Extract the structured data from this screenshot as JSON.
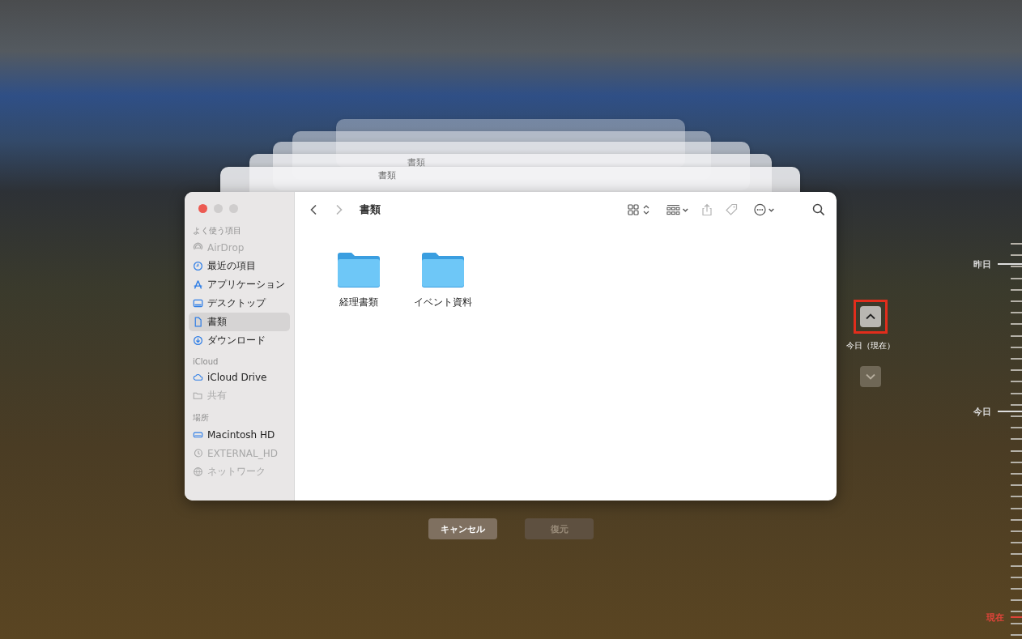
{
  "back_window_titles": [
    "書類",
    "書類"
  ],
  "window": {
    "title": "書類",
    "back_enabled": true,
    "forward_enabled": false
  },
  "sidebar": {
    "sections": [
      {
        "header": "よく使う項目",
        "items": [
          {
            "label": "AirDrop",
            "selected": false,
            "disabled": true
          },
          {
            "label": "最近の項目",
            "selected": false,
            "disabled": false
          },
          {
            "label": "アプリケーション",
            "selected": false,
            "disabled": false
          },
          {
            "label": "デスクトップ",
            "selected": false,
            "disabled": false
          },
          {
            "label": "書類",
            "selected": true,
            "disabled": false
          },
          {
            "label": "ダウンロード",
            "selected": false,
            "disabled": false
          }
        ]
      },
      {
        "header": "iCloud",
        "items": [
          {
            "label": "iCloud Drive",
            "selected": false,
            "disabled": false
          },
          {
            "label": "共有",
            "selected": false,
            "disabled": true
          }
        ]
      },
      {
        "header": "場所",
        "items": [
          {
            "label": "Macintosh HD",
            "selected": false,
            "disabled": false
          },
          {
            "label": "EXTERNAL_HD",
            "selected": false,
            "disabled": true
          },
          {
            "label": "ネットワーク",
            "selected": false,
            "disabled": true
          }
        ]
      }
    ]
  },
  "files": [
    {
      "name": "経理書類"
    },
    {
      "name": "イベント資料"
    }
  ],
  "navigation": {
    "up": {
      "highlighted": true,
      "disabled": false
    },
    "current_label": "今日（現在）",
    "down": {
      "disabled": true
    }
  },
  "buttons": [
    {
      "label": "キャンセル",
      "disabled": false
    },
    {
      "label": "復元",
      "disabled": true
    }
  ],
  "timeline": [
    {
      "label": "昨日",
      "current": false
    },
    {
      "label": "今日",
      "current": false
    },
    {
      "label": "現在",
      "current": true
    }
  ]
}
